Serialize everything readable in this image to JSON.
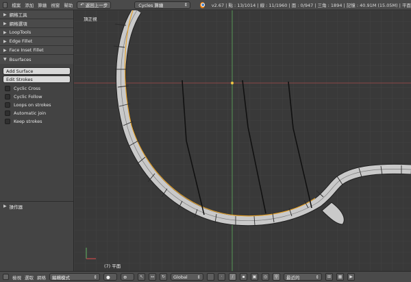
{
  "top_header": {
    "menus": [
      "檔案",
      "添加",
      "算繪",
      "視窗",
      "幫助"
    ],
    "undo_label": "返回上一步",
    "engine_label": "Cycles 算繪",
    "stats": "v2.67 | 點 : 13/1014 | 線 : 11/1960 | 面 : 0/947 | 三角 : 1894 | 記憶 : 40.91M (15.05M) | 平面"
  },
  "toolshelf": {
    "panels": [
      {
        "label": "網格工具"
      },
      {
        "label": "網格選項"
      },
      {
        "label": "LoopTools"
      },
      {
        "label": "Edge Fillet"
      },
      {
        "label": "Face Inset Fillet"
      }
    ],
    "bsurfaces": {
      "title": "Bsurfaces",
      "buttons": [
        "Add Surface",
        "Edit Strokes"
      ],
      "checkboxes": [
        "Cyclic Cross",
        "Cyclic Follow",
        "Loops on strokes",
        "Automatic join",
        "Keep strokes"
      ]
    },
    "operator_panel": {
      "title": "操作器"
    }
  },
  "viewport": {
    "view_name": "頂正視",
    "object_label": "(7) 平面",
    "colors": {
      "background": "#393939",
      "grid": "#444444",
      "y_axis": "#5ca35c",
      "x_axis": "#8a4646",
      "mesh_fill": "#c9c9c9",
      "selection": "#e5a32e",
      "stroke": "#101010"
    }
  },
  "bottom_header": {
    "menus": [
      "檢視",
      "選取",
      "網格"
    ],
    "mode": "編輯模式",
    "orientation": "Global",
    "snap": "最近的"
  }
}
